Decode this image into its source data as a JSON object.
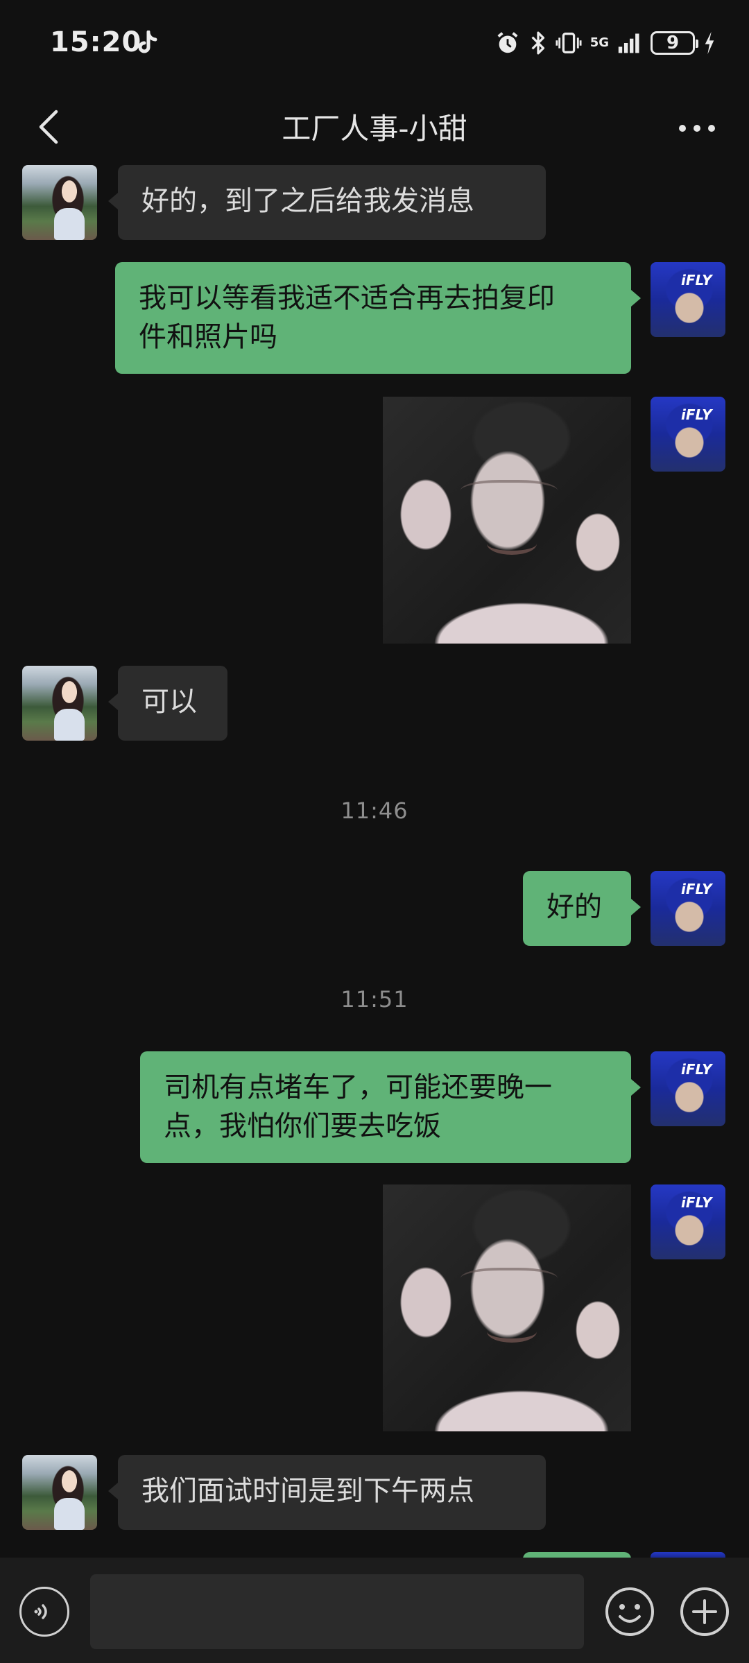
{
  "status_bar": {
    "time": "15:20",
    "network": "5G",
    "battery": "9"
  },
  "header": {
    "title": "工厂人事-小甜"
  },
  "messages": [
    {
      "id": 1,
      "side": "left",
      "type": "text",
      "text": "好的，到了之后给我发消息"
    },
    {
      "id": 2,
      "side": "right",
      "type": "text",
      "text": "我可以等看我适不适合再去拍复印件和照片吗"
    },
    {
      "id": 3,
      "side": "right",
      "type": "image"
    },
    {
      "id": 4,
      "side": "left",
      "type": "text",
      "text": "可以"
    },
    {
      "id": 5,
      "type": "timestamp",
      "text": "11:46"
    },
    {
      "id": 6,
      "side": "right",
      "type": "text",
      "text": "好的"
    },
    {
      "id": 7,
      "type": "timestamp",
      "text": "11:51"
    },
    {
      "id": 8,
      "side": "right",
      "type": "text",
      "text": "司机有点堵车了，可能还要晚一点，我怕你们要去吃饭"
    },
    {
      "id": 9,
      "side": "right",
      "type": "image"
    },
    {
      "id": 10,
      "side": "left",
      "type": "text",
      "text": "我们面试时间是到下午两点"
    }
  ],
  "m": {
    "t1": "好的，到了之后给我发消息",
    "t2a": "我可以等看我适不适合再去拍复印",
    "t2b": "件和照片吗",
    "t4": "可以",
    "ts1": "11:46",
    "t6": "好的",
    "ts2": "11:51",
    "t8a": "司机有点堵车了，可能还要晚一",
    "t8b": "点，我怕你们要去吃饭",
    "t10": "我们面试时间是到下午两点"
  },
  "avatar_text": "iFLY",
  "input": {
    "value": "",
    "placeholder": ""
  },
  "colors": {
    "background": "#111111",
    "incoming_bubble": "#2c2c2c",
    "outgoing_bubble": "#60b377",
    "input_bar": "#1c1c1c"
  },
  "icons": {
    "back": "chevron-left-icon",
    "more": "more-dots-icon",
    "voice": "voice-icon",
    "emoji": "emoji-icon",
    "add": "plus-circle-icon"
  }
}
